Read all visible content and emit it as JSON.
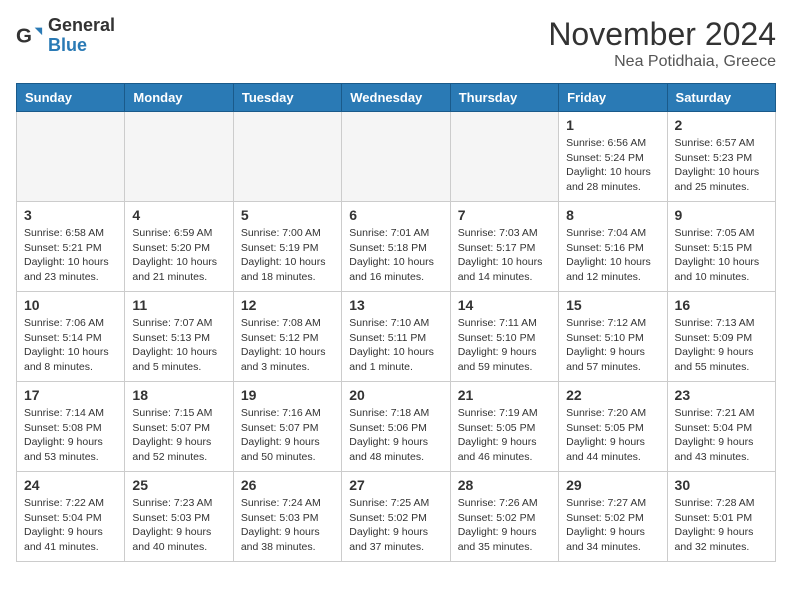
{
  "header": {
    "logo_general": "General",
    "logo_blue": "Blue",
    "month_title": "November 2024",
    "location": "Nea Potidhaia, Greece"
  },
  "weekdays": [
    "Sunday",
    "Monday",
    "Tuesday",
    "Wednesday",
    "Thursday",
    "Friday",
    "Saturday"
  ],
  "weeks": [
    [
      {
        "day": "",
        "info": ""
      },
      {
        "day": "",
        "info": ""
      },
      {
        "day": "",
        "info": ""
      },
      {
        "day": "",
        "info": ""
      },
      {
        "day": "",
        "info": ""
      },
      {
        "day": "1",
        "info": "Sunrise: 6:56 AM\nSunset: 5:24 PM\nDaylight: 10 hours and 28 minutes."
      },
      {
        "day": "2",
        "info": "Sunrise: 6:57 AM\nSunset: 5:23 PM\nDaylight: 10 hours and 25 minutes."
      }
    ],
    [
      {
        "day": "3",
        "info": "Sunrise: 6:58 AM\nSunset: 5:21 PM\nDaylight: 10 hours and 23 minutes."
      },
      {
        "day": "4",
        "info": "Sunrise: 6:59 AM\nSunset: 5:20 PM\nDaylight: 10 hours and 21 minutes."
      },
      {
        "day": "5",
        "info": "Sunrise: 7:00 AM\nSunset: 5:19 PM\nDaylight: 10 hours and 18 minutes."
      },
      {
        "day": "6",
        "info": "Sunrise: 7:01 AM\nSunset: 5:18 PM\nDaylight: 10 hours and 16 minutes."
      },
      {
        "day": "7",
        "info": "Sunrise: 7:03 AM\nSunset: 5:17 PM\nDaylight: 10 hours and 14 minutes."
      },
      {
        "day": "8",
        "info": "Sunrise: 7:04 AM\nSunset: 5:16 PM\nDaylight: 10 hours and 12 minutes."
      },
      {
        "day": "9",
        "info": "Sunrise: 7:05 AM\nSunset: 5:15 PM\nDaylight: 10 hours and 10 minutes."
      }
    ],
    [
      {
        "day": "10",
        "info": "Sunrise: 7:06 AM\nSunset: 5:14 PM\nDaylight: 10 hours and 8 minutes."
      },
      {
        "day": "11",
        "info": "Sunrise: 7:07 AM\nSunset: 5:13 PM\nDaylight: 10 hours and 5 minutes."
      },
      {
        "day": "12",
        "info": "Sunrise: 7:08 AM\nSunset: 5:12 PM\nDaylight: 10 hours and 3 minutes."
      },
      {
        "day": "13",
        "info": "Sunrise: 7:10 AM\nSunset: 5:11 PM\nDaylight: 10 hours and 1 minute."
      },
      {
        "day": "14",
        "info": "Sunrise: 7:11 AM\nSunset: 5:10 PM\nDaylight: 9 hours and 59 minutes."
      },
      {
        "day": "15",
        "info": "Sunrise: 7:12 AM\nSunset: 5:10 PM\nDaylight: 9 hours and 57 minutes."
      },
      {
        "day": "16",
        "info": "Sunrise: 7:13 AM\nSunset: 5:09 PM\nDaylight: 9 hours and 55 minutes."
      }
    ],
    [
      {
        "day": "17",
        "info": "Sunrise: 7:14 AM\nSunset: 5:08 PM\nDaylight: 9 hours and 53 minutes."
      },
      {
        "day": "18",
        "info": "Sunrise: 7:15 AM\nSunset: 5:07 PM\nDaylight: 9 hours and 52 minutes."
      },
      {
        "day": "19",
        "info": "Sunrise: 7:16 AM\nSunset: 5:07 PM\nDaylight: 9 hours and 50 minutes."
      },
      {
        "day": "20",
        "info": "Sunrise: 7:18 AM\nSunset: 5:06 PM\nDaylight: 9 hours and 48 minutes."
      },
      {
        "day": "21",
        "info": "Sunrise: 7:19 AM\nSunset: 5:05 PM\nDaylight: 9 hours and 46 minutes."
      },
      {
        "day": "22",
        "info": "Sunrise: 7:20 AM\nSunset: 5:05 PM\nDaylight: 9 hours and 44 minutes."
      },
      {
        "day": "23",
        "info": "Sunrise: 7:21 AM\nSunset: 5:04 PM\nDaylight: 9 hours and 43 minutes."
      }
    ],
    [
      {
        "day": "24",
        "info": "Sunrise: 7:22 AM\nSunset: 5:04 PM\nDaylight: 9 hours and 41 minutes."
      },
      {
        "day": "25",
        "info": "Sunrise: 7:23 AM\nSunset: 5:03 PM\nDaylight: 9 hours and 40 minutes."
      },
      {
        "day": "26",
        "info": "Sunrise: 7:24 AM\nSunset: 5:03 PM\nDaylight: 9 hours and 38 minutes."
      },
      {
        "day": "27",
        "info": "Sunrise: 7:25 AM\nSunset: 5:02 PM\nDaylight: 9 hours and 37 minutes."
      },
      {
        "day": "28",
        "info": "Sunrise: 7:26 AM\nSunset: 5:02 PM\nDaylight: 9 hours and 35 minutes."
      },
      {
        "day": "29",
        "info": "Sunrise: 7:27 AM\nSunset: 5:02 PM\nDaylight: 9 hours and 34 minutes."
      },
      {
        "day": "30",
        "info": "Sunrise: 7:28 AM\nSunset: 5:01 PM\nDaylight: 9 hours and 32 minutes."
      }
    ]
  ]
}
